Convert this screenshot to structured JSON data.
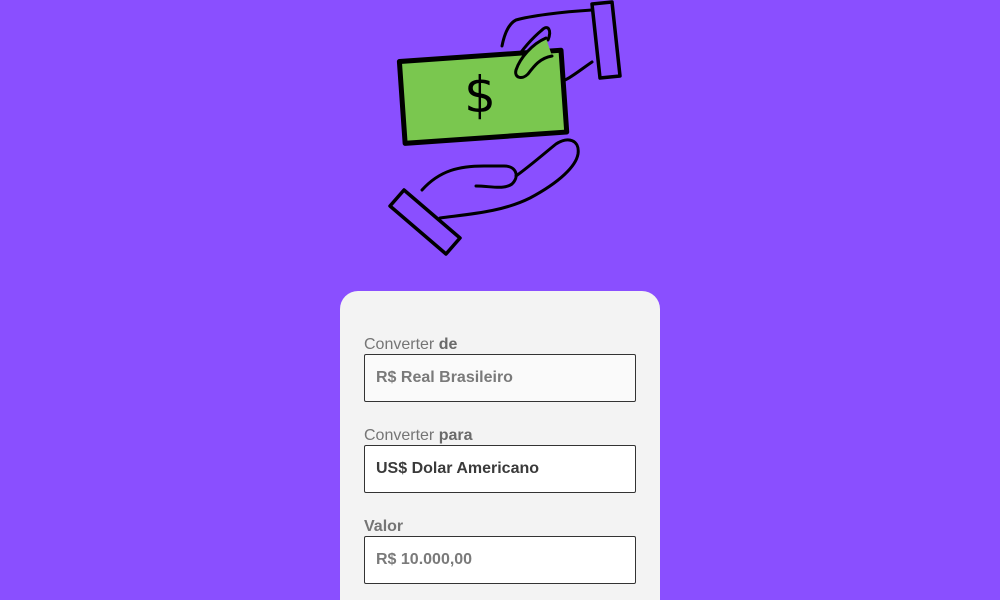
{
  "illustration": {
    "bill_symbol": "$",
    "bill_color": "#7ac74f",
    "background_color": "#8a4fff"
  },
  "form": {
    "from": {
      "label_prefix": "Converter",
      "label_strong": "de",
      "value": "R$ Real Brasileiro"
    },
    "to": {
      "label_prefix": "Converter",
      "label_strong": "para",
      "value": "US$ Dolar Americano"
    },
    "amount": {
      "label": "Valor",
      "placeholder": "R$ 10.000,00"
    }
  }
}
